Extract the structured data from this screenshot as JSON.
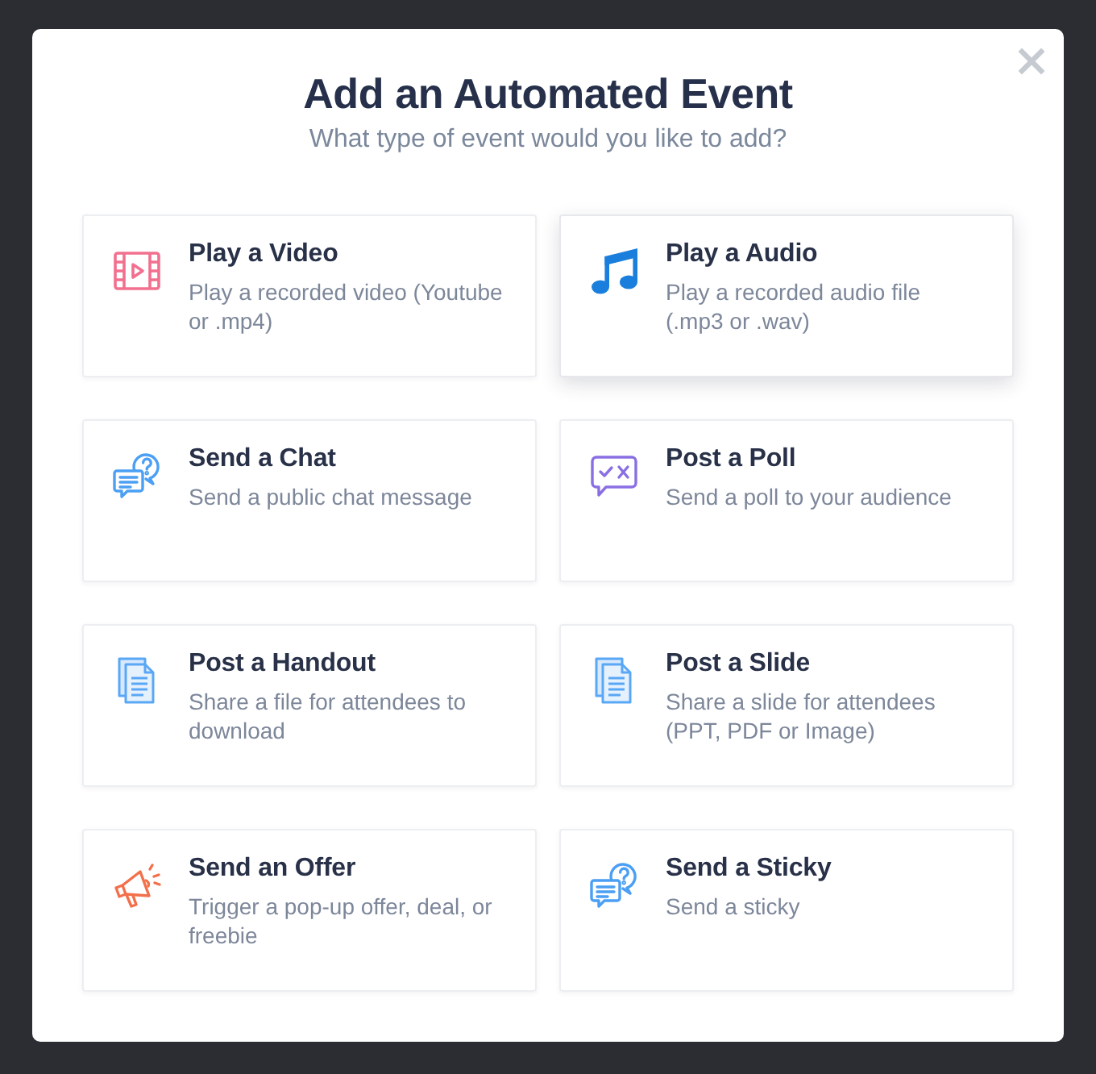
{
  "dialog": {
    "title": "Add an Automated Event",
    "subtitle": "What type of event would you like to add?"
  },
  "options": [
    {
      "kind": "video",
      "title": "Play a Video",
      "description": "Play a recorded video (Youtube or .mp4)",
      "selected": false
    },
    {
      "kind": "audio",
      "title": "Play a Audio",
      "description": "Play a recorded audio file (.mp3 or .wav)",
      "selected": true
    },
    {
      "kind": "chat",
      "title": "Send a Chat",
      "description": "Send a public chat message",
      "selected": false
    },
    {
      "kind": "poll",
      "title": "Post a Poll",
      "description": "Send a poll to your audience",
      "selected": false
    },
    {
      "kind": "document",
      "title": "Post a Handout",
      "description": "Share a file for attendees to download",
      "selected": false
    },
    {
      "kind": "document",
      "title": "Post a Slide",
      "description": "Share a slide for attendees (PPT, PDF or Image)",
      "selected": false
    },
    {
      "kind": "offer",
      "title": "Send an Offer",
      "description": "Trigger a pop-up offer, deal, or freebie",
      "selected": false
    },
    {
      "kind": "chat",
      "title": "Send a Sticky",
      "description": "Send a sticky",
      "selected": false
    }
  ]
}
